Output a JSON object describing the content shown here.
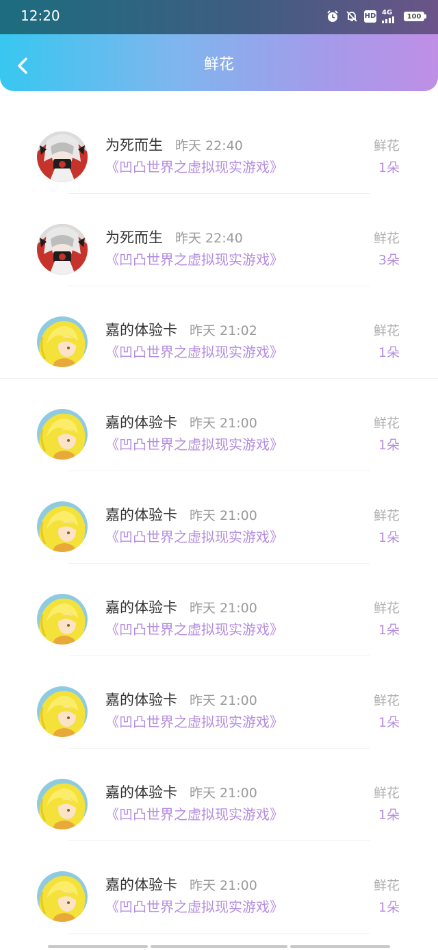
{
  "status_bar": {
    "time": "12:20",
    "network": "4G",
    "hd": "HD",
    "battery": "100",
    "icons": [
      "alarm-icon",
      "mute-bell-icon",
      "hd-icon",
      "signal-icon",
      "battery-icon"
    ]
  },
  "header": {
    "title": "鲜花",
    "back_icon": "chevron-left-icon"
  },
  "colors": {
    "accent_purple": "#b58ce0",
    "header_gradient_start": "#37c7f0",
    "header_gradient_end": "#bf8fe6"
  },
  "gift_list": [
    {
      "user": "为死而生",
      "time": "昨天 22:40",
      "book": "《凹凸世界之虚拟现实游戏》",
      "gift": "鲜花",
      "count": "1朵",
      "avatar": "red-avatar"
    },
    {
      "user": "为死而生",
      "time": "昨天 22:40",
      "book": "《凹凸世界之虚拟现实游戏》",
      "gift": "鲜花",
      "count": "3朵",
      "avatar": "red-avatar"
    },
    {
      "user": "嘉的体验卡",
      "time": "昨天 21:02",
      "book": "《凹凸世界之虚拟现实游戏》",
      "gift": "鲜花",
      "count": "1朵",
      "avatar": "yellow-avatar"
    },
    {
      "user": "嘉的体验卡",
      "time": "昨天 21:00",
      "book": "《凹凸世界之虚拟现实游戏》",
      "gift": "鲜花",
      "count": "1朵",
      "avatar": "yellow-avatar"
    },
    {
      "user": "嘉的体验卡",
      "time": "昨天 21:00",
      "book": "《凹凸世界之虚拟现实游戏》",
      "gift": "鲜花",
      "count": "1朵",
      "avatar": "yellow-avatar"
    },
    {
      "user": "嘉的体验卡",
      "time": "昨天 21:00",
      "book": "《凹凸世界之虚拟现实游戏》",
      "gift": "鲜花",
      "count": "1朵",
      "avatar": "yellow-avatar"
    },
    {
      "user": "嘉的体验卡",
      "time": "昨天 21:00",
      "book": "《凹凸世界之虚拟现实游戏》",
      "gift": "鲜花",
      "count": "1朵",
      "avatar": "yellow-avatar"
    },
    {
      "user": "嘉的体验卡",
      "time": "昨天 21:00",
      "book": "《凹凸世界之虚拟现实游戏》",
      "gift": "鲜花",
      "count": "1朵",
      "avatar": "yellow-avatar"
    },
    {
      "user": "嘉的体验卡",
      "time": "昨天 21:00",
      "book": "《凹凸世界之虚拟现实游戏》",
      "gift": "鲜花",
      "count": "1朵",
      "avatar": "yellow-avatar"
    }
  ]
}
